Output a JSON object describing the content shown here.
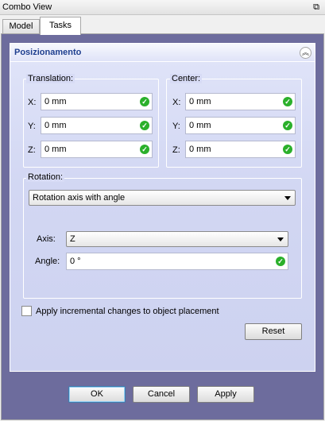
{
  "window": {
    "title": "Combo View",
    "float_icon": "float-window-icon"
  },
  "tabs": [
    {
      "label": "Model",
      "active": false
    },
    {
      "label": "Tasks",
      "active": true
    }
  ],
  "task": {
    "title": "Posizionamento",
    "collapse_icon": "chevron-up-double-icon",
    "translation": {
      "title": "Translation:",
      "x_label": "X:",
      "x_value": "0 mm",
      "y_label": "Y:",
      "y_value": "0 mm",
      "z_label": "Z:",
      "z_value": "0 mm"
    },
    "center": {
      "title": "Center:",
      "x_label": "X:",
      "x_value": "0 mm",
      "y_label": "Y:",
      "y_value": "0 mm",
      "z_label": "Z:",
      "z_value": "0 mm"
    },
    "rotation": {
      "title": "Rotation:",
      "mode": "Rotation axis with angle",
      "axis_label": "Axis:",
      "axis_value": "Z",
      "angle_label": "Angle:",
      "angle_value": "0 °"
    },
    "incremental_label": "Apply incremental changes to object placement",
    "incremental_checked": false,
    "reset_label": "Reset"
  },
  "dialog_buttons": {
    "ok": "OK",
    "cancel": "Cancel",
    "apply": "Apply"
  },
  "colors": {
    "valid_check": "#2bb02b",
    "panel_background": "#6d6c9d",
    "task_title": "#1f3f8f"
  }
}
